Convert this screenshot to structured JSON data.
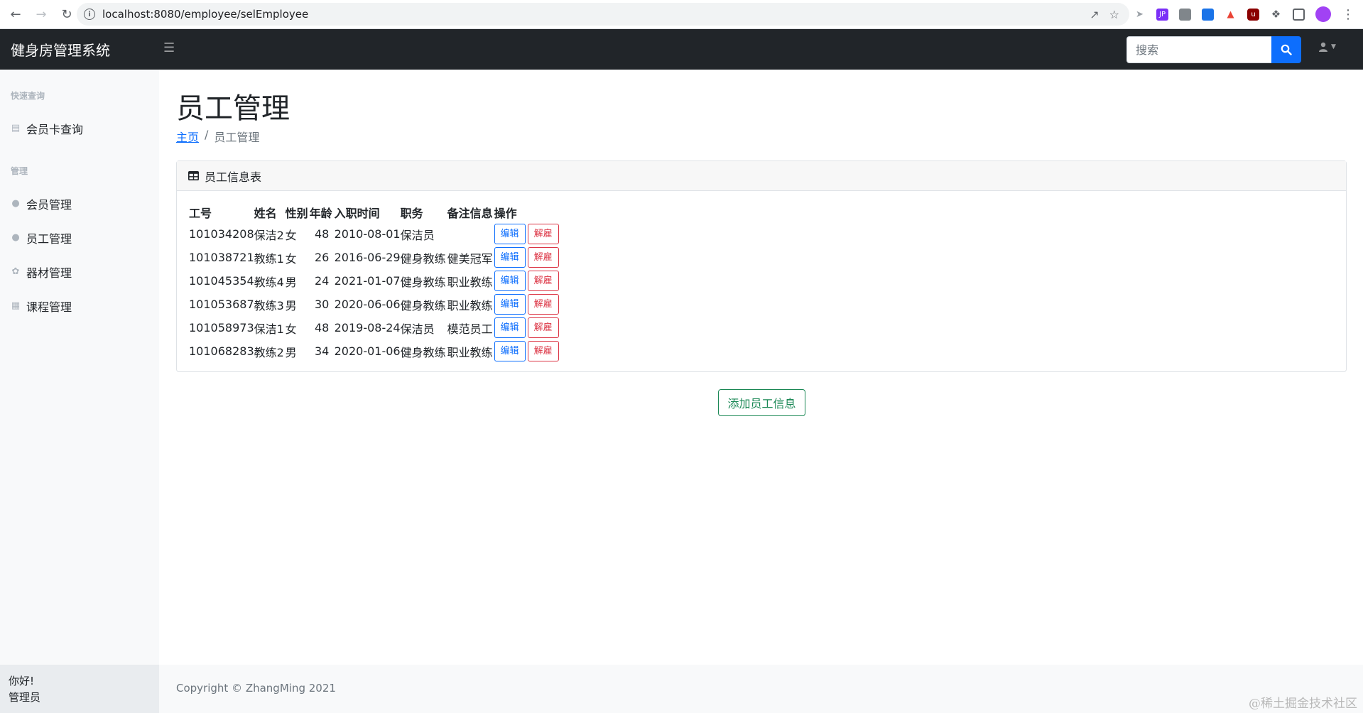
{
  "browser": {
    "url": "localhost:8080/employee/selEmployee"
  },
  "navbar": {
    "brand": "健身房管理系统",
    "search_placeholder": "搜索"
  },
  "sidebar": {
    "sections": [
      {
        "heading": "快速查询",
        "items": [
          {
            "label": "会员卡查询",
            "icon": "id-card-icon"
          }
        ]
      },
      {
        "heading": "管理",
        "items": [
          {
            "label": "会员管理",
            "icon": "user-icon"
          },
          {
            "label": "员工管理",
            "icon": "user-icon"
          },
          {
            "label": "器材管理",
            "icon": "equipment-icon"
          },
          {
            "label": "课程管理",
            "icon": "calendar-icon"
          }
        ]
      }
    ],
    "footer_greeting": "你好!",
    "footer_user": "管理员"
  },
  "main": {
    "title": "员工管理",
    "breadcrumb": {
      "home": "主页",
      "current": "员工管理"
    },
    "card_title": "员工信息表",
    "table": {
      "headers": [
        "工号",
        "姓名",
        "性别",
        "年龄",
        "入职时间",
        "职务",
        "备注信息",
        "操作"
      ],
      "rows": [
        [
          "101034208",
          "保洁2",
          "女",
          "48",
          "2010-08-01",
          "保洁员",
          ""
        ],
        [
          "101038721",
          "教练1",
          "女",
          "26",
          "2016-06-29",
          "健身教练",
          "健美冠军"
        ],
        [
          "101045354",
          "教练4",
          "男",
          "24",
          "2021-01-07",
          "健身教练",
          "职业教练"
        ],
        [
          "101053687",
          "教练3",
          "男",
          "30",
          "2020-06-06",
          "健身教练",
          "职业教练"
        ],
        [
          "101058973",
          "保洁1",
          "女",
          "48",
          "2019-08-24",
          "保洁员",
          "模范员工"
        ],
        [
          "101068283",
          "教练2",
          "男",
          "34",
          "2020-01-06",
          "健身教练",
          "职业教练"
        ]
      ],
      "edit_label": "编辑",
      "fire_label": "解雇"
    },
    "add_button": "添加员工信息"
  },
  "footer": {
    "copyright": "Copyright © ZhangMing 2021",
    "watermark": "@稀土掘金技术社区"
  },
  "colors": {
    "navbar_bg": "#212529",
    "primary": "#0d6efd",
    "danger": "#dc3545",
    "success": "#198754"
  }
}
